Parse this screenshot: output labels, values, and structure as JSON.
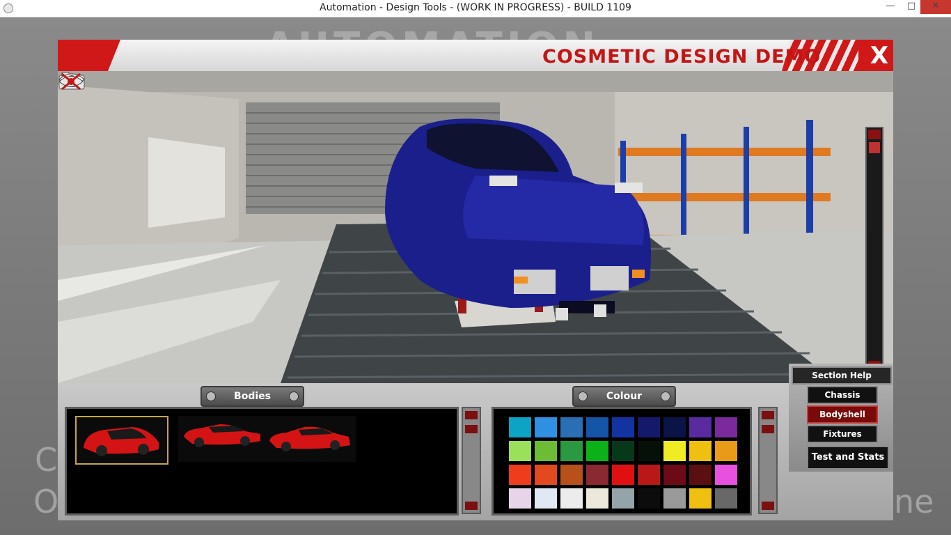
{
  "window": {
    "title": "Automation - Design Tools - (WORK IN PROGRESS) - BUILD 1109",
    "minimize_glyph": "—",
    "maximize_glyph": "□",
    "close_glyph": "✕"
  },
  "background": {
    "logo_text": "AUTOMATION",
    "left_letters": [
      "C",
      "O"
    ],
    "right_letters": [
      "ne"
    ]
  },
  "dialog": {
    "title": "COSMETIC DESIGN DEMO",
    "close_label": "X"
  },
  "viewport": {
    "camera_icon": "camera-icon",
    "eye_icon": "eye-icon",
    "hide_icon": "hide-ui-icon"
  },
  "bodies_panel": {
    "header": "Bodies",
    "items": [
      {
        "name": "hatchback",
        "color": "#d41414",
        "selected": true
      },
      {
        "name": "sedan",
        "color": "#d41414",
        "selected": false
      },
      {
        "name": "coupe",
        "color": "#d41414",
        "selected": false
      }
    ]
  },
  "colour_panel": {
    "header": "Colour",
    "swatches": [
      [
        "#0da3c4",
        "#2f8fe0",
        "#2a6fb4",
        "#1455a8",
        "#1233a0",
        "#14196a",
        "#0b1446",
        "#5a2aa0",
        "#7a2a9a"
      ],
      [
        "#9ae05a",
        "#6cbc36",
        "#2a9a40",
        "#0cb018",
        "#08381a",
        "#051008",
        "#f0ec24",
        "#f0c010",
        "#e89a18"
      ],
      [
        "#ee3c1c",
        "#e04a1e",
        "#b8501a",
        "#8a2a30",
        "#e01010",
        "#b81818",
        "#6c0a18",
        "#5a1010",
        "#e850e0"
      ],
      [
        "#e8d4e8",
        "#e0e8f4",
        "#ececec",
        "#ece8dc",
        "#94a4a8",
        "#0c0c0c",
        "#9a9a9a",
        "#f0c010",
        "#686868"
      ]
    ]
  },
  "section_menu": {
    "help_label": "Section Help",
    "items": [
      {
        "label": "Chassis",
        "active": false
      },
      {
        "label": "Bodyshell",
        "active": true
      },
      {
        "label": "Fixtures",
        "active": false
      }
    ],
    "test_label": "Test and Stats"
  },
  "colors": {
    "accent_red": "#d11818",
    "car_paint": "#1a1f8c"
  }
}
